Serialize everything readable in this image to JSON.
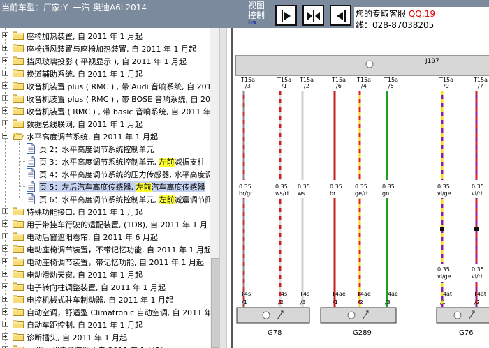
{
  "header": {
    "car_label": "当前车型：厂家:Y--一汽-奥迪A6L2014-",
    "view_label_1": "视图",
    "view_label_2": "控制",
    "view_tag": "lis",
    "nav_buttons": [
      "previous-page",
      "page-split",
      "next-page"
    ],
    "service_text": "您的专取客服",
    "service_qq": "QQ:19",
    "service_phone": "线：028-87038205"
  },
  "tree": {
    "items": [
      {
        "type": "folder",
        "label": "座椅加热装置, 自 2011 年 1 月起"
      },
      {
        "type": "folder",
        "label": "座椅通风装置与座椅加热装置, 自 2011 年 1 月起"
      },
      {
        "type": "folder",
        "label": "挡风玻璃投影 ( 平视显示 ), 自 2011 年 1 月起"
      },
      {
        "type": "folder",
        "label": "换道辅助系统, 自 2011 年 1 月起"
      },
      {
        "type": "folder",
        "label": "收音机装置 plus ( RMC ) , 带 Audi 音响系统, 自 2011"
      },
      {
        "type": "folder",
        "label": "收音机装置 plus ( RMC ) , 带 BOSE 音响系统, 自 2011"
      },
      {
        "type": "folder",
        "label": "收音机装置 ( RMC ) , 带 basic 音响系统, 自 2011 年"
      },
      {
        "type": "folder",
        "label": "数据总线联网, 自 2011 年 1 月起"
      },
      {
        "type": "folder-open",
        "label": "水平高度调节系统, 自 2011 年 1 月起"
      },
      {
        "type": "page",
        "label": "页 2：水平高度调节系统控制单元"
      },
      {
        "type": "page",
        "pre": "页 3：水平高度调节系统控制单元, ",
        "hl": "左前",
        "post": "减振支柱"
      },
      {
        "type": "page",
        "label": "页 4：水平高度调节系统的压力传感器, 水平高度调"
      },
      {
        "type": "page",
        "selected": true,
        "pre": "页 5：左后汽车高度传感器, ",
        "hl": "左前",
        "post": "汽车高度传感器"
      },
      {
        "type": "page",
        "pre": "页 6：水平高度调节系统控制单元, ",
        "hl": "左前",
        "post": "减震调节阀"
      },
      {
        "type": "folder",
        "label": "特殊功能接口, 自 2011 年 1 月起"
      },
      {
        "type": "folder",
        "label": "用于带挂车行驶的适配装置, (1D8), 自 2011 年 1 月"
      },
      {
        "type": "folder",
        "label": "电动后窗遮阳卷帘, 自 2011 年 6 月起"
      },
      {
        "type": "folder",
        "label": "电动座椅调节装置，不带记忆功能, 自 2011 年 1 月起"
      },
      {
        "type": "folder",
        "label": "电动座椅调节装置，带记忆功能, 自 2011 年 1 月起"
      },
      {
        "type": "folder",
        "label": "电动滑动天窗, 自 2011 年 1 月起"
      },
      {
        "type": "folder",
        "label": "电子转向柱调整装置, 自 2011 年 1 月起"
      },
      {
        "type": "folder",
        "label": "电控机械式驻车制动器, 自 2011 年 1 月起"
      },
      {
        "type": "folder",
        "label": "自动空调，舒适型 Climatronic 自动空调, 自 2011 年"
      },
      {
        "type": "folder",
        "label": "自动车距控制, 自 2011 年 1 月起"
      },
      {
        "type": "folder",
        "label": "诊断插头, 自 2011 年 1 月起"
      },
      {
        "type": "folder",
        "label": "... 旧一代电子装置 ( 自 2011 年 1 月起"
      }
    ]
  },
  "diagram": {
    "top_unit": "J197",
    "wires": [
      {
        "pin": "T15a",
        "num": "/3",
        "size": "0.35",
        "color": "br/gr",
        "colors": [
          "#c03030",
          "#8a8a8a"
        ],
        "bottom_pin": "T4s",
        "bottom_num": "/1"
      },
      {
        "pin": "T15a",
        "num": "/1",
        "size": "0.35",
        "color": "ws/rt",
        "colors": [
          "#dddddd",
          "#d02020"
        ],
        "bottom_pin": "T4s",
        "bottom_num": "/2"
      },
      {
        "pin": "T15a",
        "num": "/2",
        "size": "0.35",
        "color": "ws",
        "colors": [
          "#cfcfcf",
          "#cfcfcf"
        ],
        "bottom_pin": "T4s",
        "bottom_num": "/3"
      },
      {
        "pin": "T15a",
        "num": "/6",
        "size": "0.35",
        "color": "br",
        "colors": [
          "#c02020",
          "#c02020"
        ],
        "bottom_pin": "T4ae",
        "bottom_num": "/1"
      },
      {
        "pin": "T15a",
        "num": "/4",
        "size": "0.35",
        "color": "ge/rt",
        "colors": [
          "#f4e010",
          "#e02020"
        ],
        "bottom_pin": "T4ae",
        "bottom_num": "/2"
      },
      {
        "pin": "T15a",
        "num": "/5",
        "size": "0.35",
        "color": "gn",
        "colors": [
          "#20a020",
          "#20a020"
        ],
        "bottom_pin": "T4ae",
        "bottom_num": "/3"
      },
      {
        "pin": "T15a",
        "num": "/9",
        "size": "0.35",
        "color": "vi/ge",
        "colors": [
          "#8a20a0",
          "#f4e010"
        ],
        "size2": "0.35",
        "color2": "vi/ge",
        "bottom_pin": "T4at",
        "bottom_num": "/1"
      },
      {
        "pin": "T15a",
        "num": "/7",
        "size": "0.35",
        "color": "vi/rt",
        "colors": [
          "#8a20a0",
          "#e02020"
        ],
        "size2": "0.35",
        "color2": "vi/rt",
        "bottom_pin": "T4at",
        "bottom_num": "/2"
      }
    ],
    "components": [
      {
        "label": "G78"
      },
      {
        "label": "G289"
      },
      {
        "label": "G76"
      }
    ]
  }
}
